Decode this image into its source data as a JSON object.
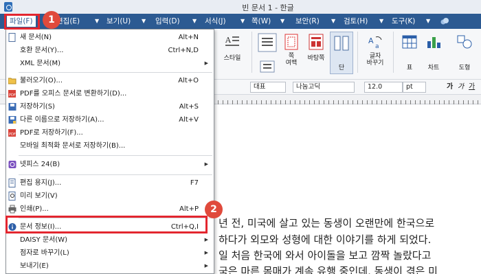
{
  "window": {
    "title": "빈 문서 1 - 한글"
  },
  "menubar": {
    "items": [
      {
        "label": "파일(F)"
      },
      {
        "label": "편집(E)"
      },
      {
        "label": "보기(U)"
      },
      {
        "label": "입력(D)"
      },
      {
        "label": "서식(J)"
      },
      {
        "label": "쪽(W)"
      },
      {
        "label": "보안(R)"
      },
      {
        "label": "검토(H)"
      },
      {
        "label": "도구(K)"
      }
    ]
  },
  "ribbon": {
    "style_label": "스타일",
    "margin_label": "쪽\n여백",
    "background_label": "바탕쪽",
    "column_label": "단",
    "char_label": "글자\n바꾸기",
    "table_label": "표",
    "chart_label": "차트",
    "shape_label": "도형"
  },
  "format_bar": {
    "style": "대표",
    "font": "나눔고딕",
    "size": "12.0",
    "unit": "pt",
    "bold": "가",
    "italic": "가",
    "underline": "가"
  },
  "file_menu": {
    "items": [
      {
        "label": "새 문서(N)",
        "shortcut": "Alt+N",
        "icon": "new-doc-icon"
      },
      {
        "label": "호환 문서(Y)...",
        "shortcut": "Ctrl+N,D",
        "icon": ""
      },
      {
        "label": "XML 문서(M)",
        "shortcut": "",
        "icon": "",
        "submenu": true
      },
      {
        "label": "불러오기(O)...",
        "shortcut": "Alt+O",
        "icon": "open-folder-icon"
      },
      {
        "label": "PDF를 오피스 문서로 변환하기(D)...",
        "shortcut": "",
        "icon": "pdf-convert-icon"
      },
      {
        "label": "저장하기(S)",
        "shortcut": "Alt+S",
        "icon": "save-icon"
      },
      {
        "label": "다른 이름으로 저장하기(A)...",
        "shortcut": "Alt+V",
        "icon": "save-as-icon"
      },
      {
        "label": "PDF로 저장하기(F)...",
        "shortcut": "",
        "icon": "pdf-save-icon"
      },
      {
        "label": "모바일 최적화 문서로 저장하기(B)...",
        "shortcut": "",
        "icon": ""
      },
      {
        "label": "넷피스 24(B)",
        "shortcut": "",
        "icon": "netffice-icon",
        "submenu": true
      },
      {
        "label": "편집 용지(J)...",
        "shortcut": "F7",
        "icon": "page-setup-icon"
      },
      {
        "label": "미리 보기(V)",
        "shortcut": "",
        "icon": "preview-icon"
      },
      {
        "label": "인쇄(P)...",
        "shortcut": "Alt+P",
        "icon": "print-icon"
      },
      {
        "label": "문서 정보(I)...",
        "shortcut": "Ctrl+Q,I",
        "icon": "doc-info-icon"
      },
      {
        "label": "DAISY 문서(W)",
        "shortcut": "",
        "icon": "",
        "submenu": true
      },
      {
        "label": "점자로 바꾸기(L)",
        "shortcut": "",
        "icon": "",
        "submenu": true
      },
      {
        "label": "보내기(E)",
        "shortcut": "",
        "icon": "",
        "submenu": true
      }
    ]
  },
  "document": {
    "lines": [
      "년 전, 미국에 살고 있는 동생이 오랜만에 한국으로",
      "하다가 외모와 성형에 대한 이야기를 하게 되었다.",
      "일 처음 한국에 와서 아이돌을 보고 깜짝 놀랐다고",
      "국은 마른 몸매가 계속 유행 중인데, 동생이 겪은 미"
    ]
  },
  "annotations": {
    "step1": "1",
    "step2": "2"
  },
  "colors": {
    "menubar": "#2c5a92",
    "highlight": "#e3262f",
    "badge": "#e04a3c"
  }
}
